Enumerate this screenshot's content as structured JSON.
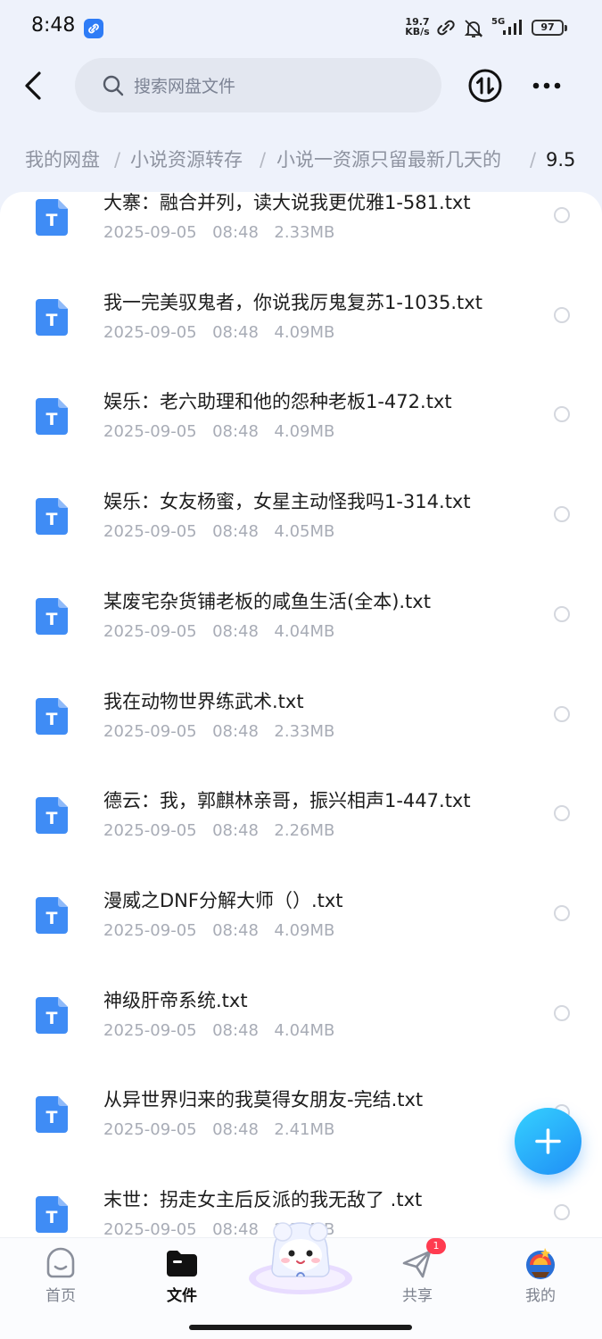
{
  "status_bar": {
    "time": "8:48",
    "speed_value": "19.7",
    "speed_unit": "KB/s",
    "network": "5G",
    "battery": "97"
  },
  "header": {
    "search_placeholder": "搜索网盘文件"
  },
  "breadcrumb": {
    "items": [
      "我的网盘",
      "小说资源转存",
      "小说一资源只留最新几天的",
      "9.5"
    ],
    "separator": "/"
  },
  "files": [
    {
      "name": "大寨：融合并列，读大说我更优雅1-581.txt",
      "date": "2025-09-05",
      "time": "08:48",
      "size": "2.33MB"
    },
    {
      "name": "我一完美驭鬼者，你说我厉鬼复苏1-1035.txt",
      "date": "2025-09-05",
      "time": "08:48",
      "size": "4.09MB"
    },
    {
      "name": "娱乐：老六助理和他的怨种老板1-472.txt",
      "date": "2025-09-05",
      "time": "08:48",
      "size": "4.09MB"
    },
    {
      "name": "娱乐：女友杨蜜，女星主动怪我吗1-314.txt",
      "date": "2025-09-05",
      "time": "08:48",
      "size": "4.05MB"
    },
    {
      "name": "某废宅杂货铺老板的咸鱼生活(全本).txt",
      "date": "2025-09-05",
      "time": "08:48",
      "size": "4.04MB"
    },
    {
      "name": "我在动物世界练武术.txt",
      "date": "2025-09-05",
      "time": "08:48",
      "size": "2.33MB"
    },
    {
      "name": "德云：我，郭麒林亲哥，振兴相声1-447.txt",
      "date": "2025-09-05",
      "time": "08:48",
      "size": "2.26MB"
    },
    {
      "name": "漫威之DNF分解大师（）.txt",
      "date": "2025-09-05",
      "time": "08:48",
      "size": "4.09MB"
    },
    {
      "name": "神级肝帝系统.txt",
      "date": "2025-09-05",
      "time": "08:48",
      "size": "4.04MB"
    },
    {
      "name": "从异世界归来的我莫得女朋友-完结.txt",
      "date": "2025-09-05",
      "time": "08:48",
      "size": "2.41MB"
    },
    {
      "name": "末世：拐走女主后反派的我无敌了 .txt",
      "date": "2025-09-05",
      "time": "08:48",
      "size": "2.33MB"
    }
  ],
  "file_icon_letter": "T",
  "fab_icon": "plus-icon",
  "bottom_nav": {
    "items": [
      {
        "label": "首页",
        "icon": "home-icon",
        "active": false
      },
      {
        "label": "文件",
        "icon": "folder-icon",
        "active": true
      },
      {
        "label": "共享",
        "icon": "send-icon",
        "active": false,
        "badge": "1"
      },
      {
        "label": "我的",
        "icon": "avatar-icon",
        "active": false
      }
    ]
  },
  "colors": {
    "accent": "#2e7cf6",
    "file_icon": "#3f8cf5",
    "badge": "#ff3b50",
    "text_primary": "#1d1d1d",
    "text_secondary": "#a8acb6"
  }
}
